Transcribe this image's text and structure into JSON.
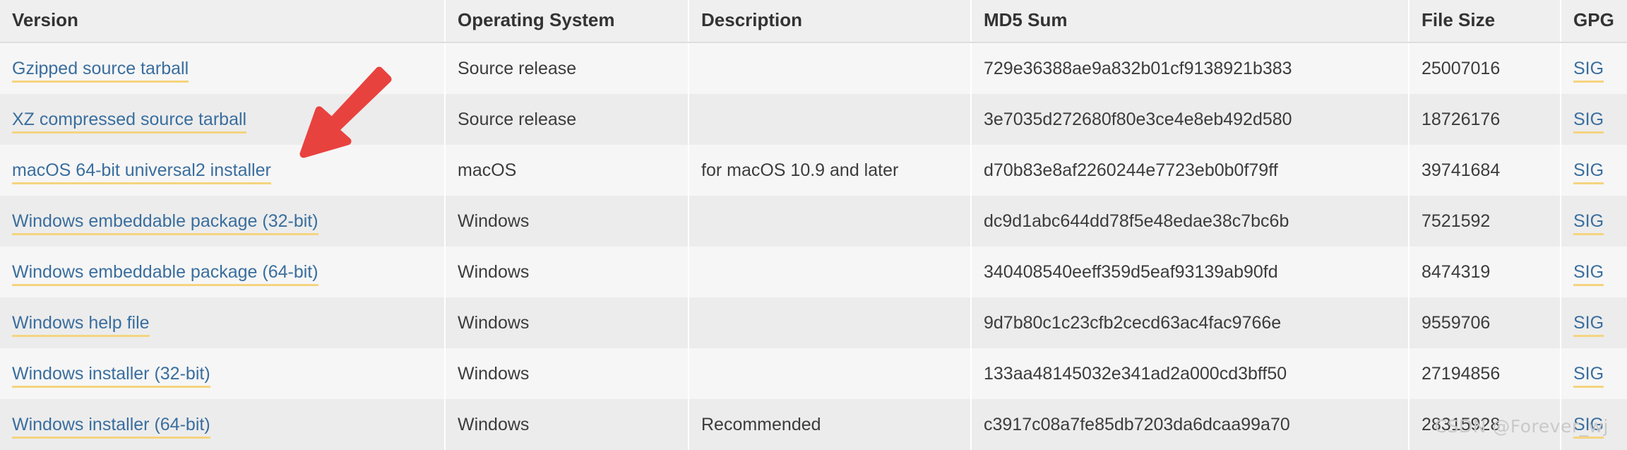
{
  "table": {
    "columns": [
      "Version",
      "Operating System",
      "Description",
      "MD5 Sum",
      "File Size",
      "GPG"
    ],
    "rows": [
      {
        "version": "Gzipped source tarball",
        "os": "Source release",
        "description": "",
        "md5": "729e36388ae9a832b01cf9138921b383",
        "size": "25007016",
        "gpg": "SIG"
      },
      {
        "version": "XZ compressed source tarball",
        "os": "Source release",
        "description": "",
        "md5": "3e7035d272680f80e3ce4e8eb492d580",
        "size": "18726176",
        "gpg": "SIG"
      },
      {
        "version": "macOS 64-bit universal2 installer",
        "os": "macOS",
        "description": "for macOS 10.9 and later",
        "md5": "d70b83e8af2260244e7723eb0b0f79ff",
        "size": "39741684",
        "gpg": "SIG"
      },
      {
        "version": "Windows embeddable package (32-bit)",
        "os": "Windows",
        "description": "",
        "md5": "dc9d1abc644dd78f5e48edae38c7bc6b",
        "size": "7521592",
        "gpg": "SIG"
      },
      {
        "version": "Windows embeddable package (64-bit)",
        "os": "Windows",
        "description": "",
        "md5": "340408540eeff359d5eaf93139ab90fd",
        "size": "8474319",
        "gpg": "SIG"
      },
      {
        "version": "Windows help file",
        "os": "Windows",
        "description": "",
        "md5": "9d7b80c1c23cfb2cecd63ac4fac9766e",
        "size": "9559706",
        "gpg": "SIG"
      },
      {
        "version": "Windows installer (32-bit)",
        "os": "Windows",
        "description": "",
        "md5": "133aa48145032e341ad2a000cd3bff50",
        "size": "27194856",
        "gpg": "SIG"
      },
      {
        "version": "Windows installer (64-bit)",
        "os": "Windows",
        "description": "Recommended",
        "md5": "c3917c08a7fe85db7203da6dcaa99a70",
        "size": "28315928",
        "gpg": "SIG"
      }
    ]
  },
  "annotation": {
    "arrow_color": "#e8423f",
    "arrow_points_to": "macOS 64-bit universal2 installer"
  },
  "watermark": {
    "text": "CSDN @Forever_wj"
  },
  "colors": {
    "link": "#3a6e9e",
    "link_underline": "#f5d47f",
    "header_bg": "#efefef",
    "row_odd_bg": "#f6f6f6",
    "row_even_bg": "#ececec",
    "text": "#3c3c3c",
    "arrow_red": "#e8423f"
  }
}
